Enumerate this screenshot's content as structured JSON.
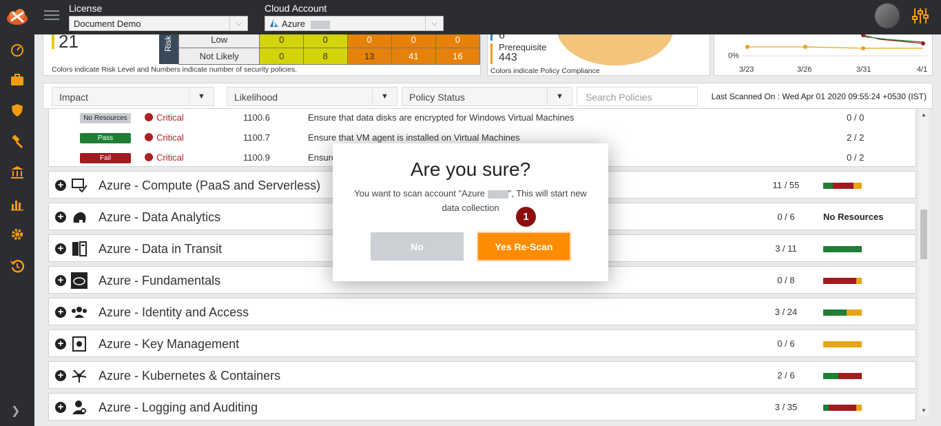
{
  "header": {
    "license_label": "License",
    "license_value": "Document Demo",
    "cloud_account_label": "Cloud Account",
    "cloud_account_value": "Azure"
  },
  "summary": {
    "count": "21",
    "risk_axis_label": "Risk",
    "risk_rows": [
      {
        "label": "Low",
        "values": [
          "0",
          "0",
          "0",
          "0",
          "0"
        ]
      },
      {
        "label": "Not Likely",
        "values": [
          "0",
          "8",
          "13",
          "41",
          "16"
        ]
      }
    ],
    "caption": "Colors indicate Risk Level and Numbers indicate number of security policies.",
    "compliance_num1": "6",
    "prerequisite_label": "Prerequisite",
    "prerequisite_value": "443",
    "compliance_caption": "Colors indicate Policy Compliance",
    "trend_y_label": "0%",
    "trend_dates": [
      "3/23",
      "3/26",
      "3/31",
      "4/1"
    ]
  },
  "filters": {
    "impact": "Impact",
    "likelihood": "Likelihood",
    "policy_status": "Policy Status",
    "search_placeholder": "Search Policies",
    "last_scanned": "Last Scanned On : Wed Apr 01 2020 09:55:24 +0530 (IST)"
  },
  "policies": [
    {
      "status": "No Resources",
      "severity": "Critical",
      "id": "1100.6",
      "description": "Ensure that data disks are encrypted for Windows Virtual Machines",
      "score": "0 / 0"
    },
    {
      "status": "Pass",
      "severity": "Critical",
      "id": "1100.7",
      "description": "Ensure that VM agent is installed on Virtual Machines",
      "score": "2 / 2"
    },
    {
      "status": "Fail",
      "severity": "Critical",
      "id": "1100.9",
      "description": "Ensure",
      "score": "0 / 2"
    }
  ],
  "categories": [
    {
      "name": "Azure - Compute (PaaS and Serverless)",
      "count": "11 / 55",
      "icon": "monitor-check-icon",
      "bar": [
        {
          "c": "#1e7e34",
          "w": 14
        },
        {
          "c": "#a01c20",
          "w": 30
        },
        {
          "c": "#e8a317",
          "w": 12
        }
      ]
    },
    {
      "name": "Azure - Data Analytics",
      "count": "0 / 6",
      "icon": "elephant-icon",
      "no_resources": "No Resources"
    },
    {
      "name": "Azure - Data in Transit",
      "count": "3 / 11",
      "icon": "server-transfer-icon",
      "bar": [
        {
          "c": "#1e7e34",
          "w": 56
        }
      ]
    },
    {
      "name": "Azure - Fundamentals",
      "count": "0 / 8",
      "icon": "cloud-icon",
      "bar": [
        {
          "c": "#a01c20",
          "w": 48
        },
        {
          "c": "#e8a317",
          "w": 8
        }
      ]
    },
    {
      "name": "Azure - Identity and Access",
      "count": "3 / 24",
      "icon": "users-icon",
      "bar": [
        {
          "c": "#1e7e34",
          "w": 34
        },
        {
          "c": "#e8a317",
          "w": 22
        }
      ]
    },
    {
      "name": "Azure - Key Management",
      "count": "0 / 6",
      "icon": "key-vault-icon",
      "bar": [
        {
          "c": "#e8a317",
          "w": 56
        }
      ]
    },
    {
      "name": "Azure - Kubernetes & Containers",
      "count": "2 / 6",
      "icon": "cluster-icon",
      "bar": [
        {
          "c": "#1e7e34",
          "w": 22
        },
        {
          "c": "#a01c20",
          "w": 34
        }
      ]
    },
    {
      "name": "Azure - Logging and Auditing",
      "count": "3 / 35",
      "icon": "user-search-icon",
      "bar": [
        {
          "c": "#1e7e34",
          "w": 8
        },
        {
          "c": "#a01c20",
          "w": 40
        },
        {
          "c": "#e8a317",
          "w": 8
        }
      ]
    }
  ],
  "dialog": {
    "title": "Are you sure?",
    "message_part1": "You want to scan account \"Azure ",
    "message_part2": "\", This will start new data collection",
    "no_label": "No",
    "yes_label": "Yes Re-Scan",
    "step_number": "1"
  }
}
